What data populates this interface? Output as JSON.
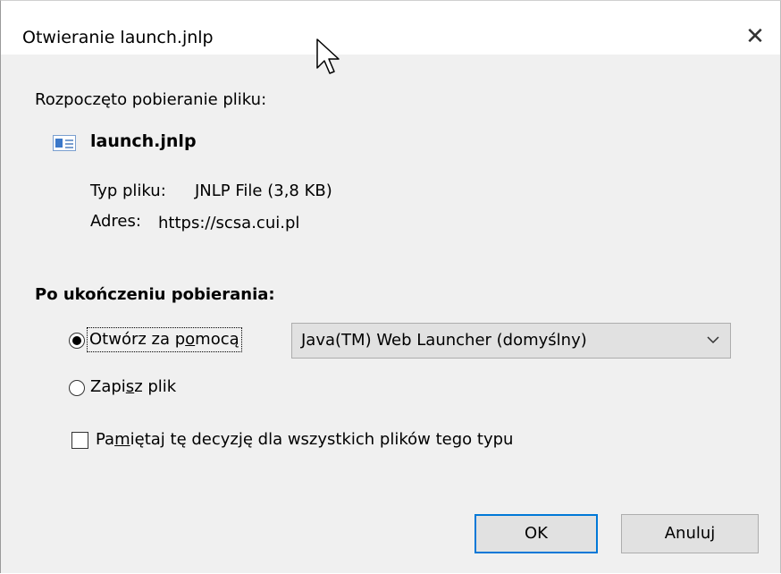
{
  "window": {
    "title": "Otwieranie launch.jnlp",
    "close_glyph": "✕"
  },
  "download": {
    "heading": "Rozpoczęto pobieranie pliku:",
    "file_name": "launch.jnlp",
    "file_icon": "jnlp-file-icon",
    "type_label": "Typ pliku:",
    "type_value": "JNLP File (3,8 KB)",
    "address_label": "Adres:",
    "address_value": "https://scsa.cui.pl"
  },
  "after_download": {
    "heading": "Po ukończeniu pobierania:",
    "open_with": {
      "label_prefix": "Otwórz za p",
      "label_accel": "o",
      "label_suffix": "mocą",
      "selected": true
    },
    "application_select": {
      "value": "Java(TM) Web Launcher (domyślny)"
    },
    "save_file": {
      "label_prefix": "Zapi",
      "label_accel": "s",
      "label_suffix": "z plik",
      "selected": false
    },
    "remember": {
      "label_prefix": "Pa",
      "label_accel": "m",
      "label_suffix": "iętaj tę decyzję dla wszystkich plików tego typu",
      "checked": false
    }
  },
  "buttons": {
    "ok": "OK",
    "cancel": "Anuluj"
  },
  "colors": {
    "accent": "#0078d7",
    "dialog_background": "#f0f0f0",
    "button_background": "#e1e1e1"
  }
}
